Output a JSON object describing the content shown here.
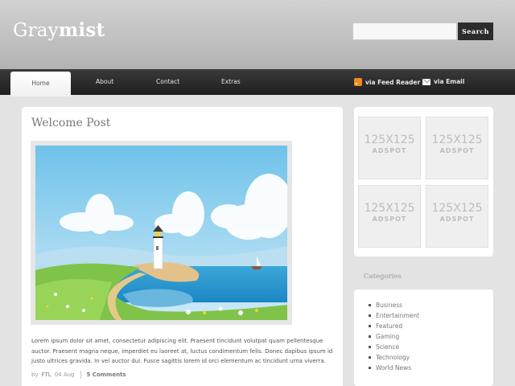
{
  "header": {
    "logo_light": "Gray",
    "logo_bold": "mist",
    "search_placeholder": "",
    "search_button": "Search"
  },
  "nav": {
    "items": [
      "Home",
      "About",
      "Contact",
      "Extras"
    ],
    "active": "Home",
    "feed_reader": "via Feed Reader",
    "email": "via Email"
  },
  "post": {
    "title": "Welcome Post",
    "body": "Lorem ipsum dolor sit amet, consectetur adipiscing elit. Praesent tincidunt volutpat quam pellentesque auctor. Praesent magna neque, imperdiet eu laoreet at, luctus condimentum felis. Donec dapibus ipsum id justo ultrices gravida. In vel auctor dui. Fusce sagittis lorem id orci elementum ac tincidunt urna viverra.",
    "author_prefix": "by",
    "author": "FTL",
    "date": "04 Aug",
    "comments": "5 Comments"
  },
  "ads": [
    {
      "size": "125X125",
      "label": "ADSPOT"
    },
    {
      "size": "125X125",
      "label": "ADSPOT"
    },
    {
      "size": "125X125",
      "label": "ADSPOT"
    },
    {
      "size": "125X125",
      "label": "ADSPOT"
    }
  ],
  "categories": {
    "title": "Categories",
    "items": [
      "Business",
      "Entertainment",
      "Featured",
      "Gaming",
      "Science",
      "Technology",
      "World News"
    ]
  },
  "icons": {
    "feed": "rss-icon",
    "email": "mail-icon"
  }
}
